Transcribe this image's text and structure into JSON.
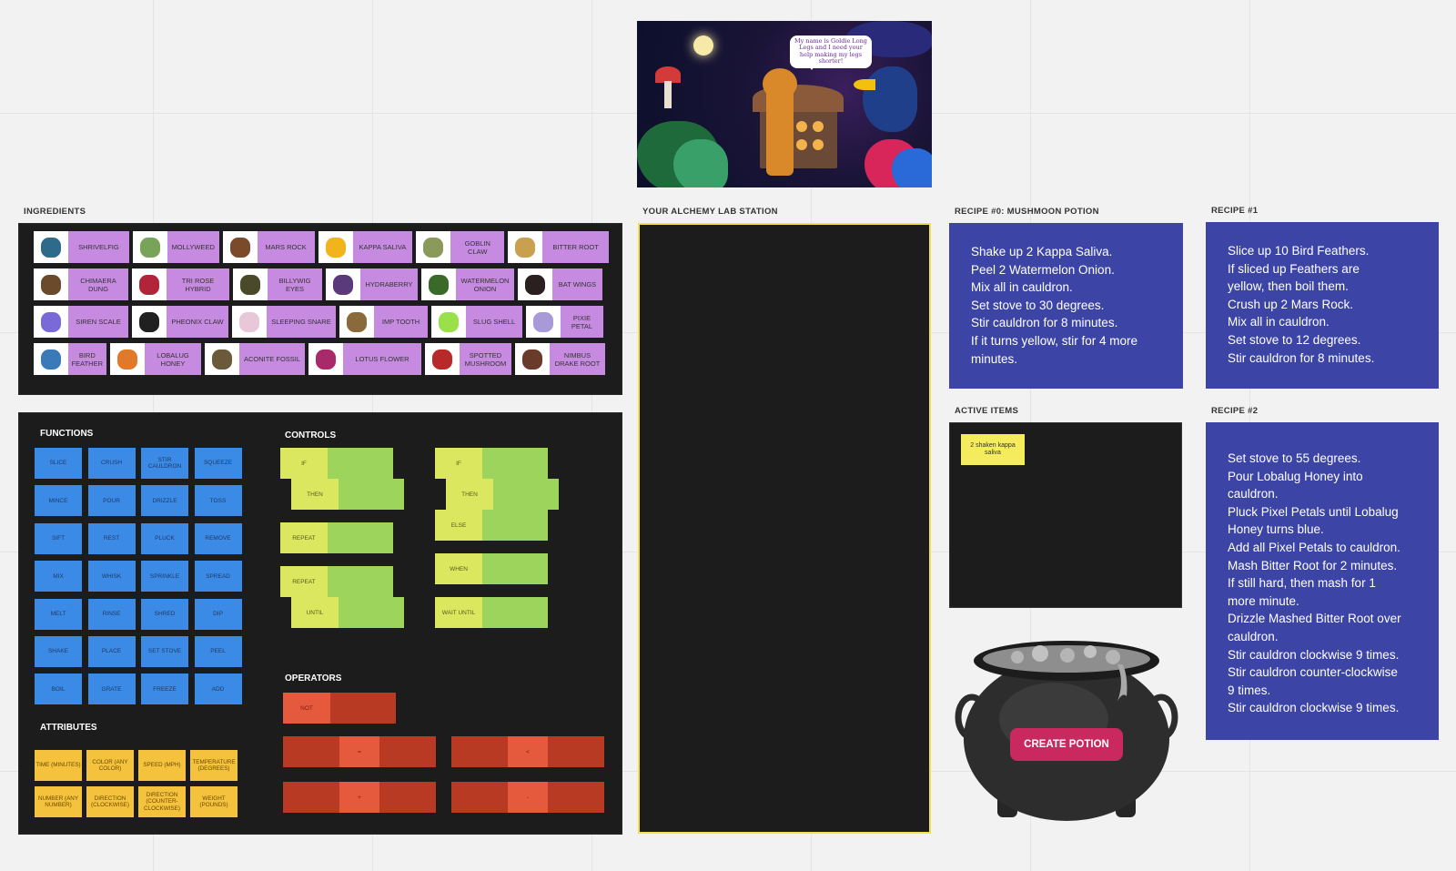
{
  "hero": {
    "speech": "My name is Goldie Long Legs and I need your help making my legs shorter!"
  },
  "sections": {
    "ingredients": "INGREDIENTS",
    "lab_station": "YOUR ALCHEMY LAB STATION",
    "recipe0": "RECIPE #0: MUSHMOON POTION",
    "recipe1": "RECIPE #1",
    "recipe2": "RECIPE #2",
    "active_items": "ACTIVE ITEMS"
  },
  "ingredients": [
    [
      {
        "label": "SHRIVELFIG",
        "color": "#2e6a8a"
      },
      {
        "label": "MOLLYWEED",
        "color": "#7aa35a"
      },
      {
        "label": "MARS ROCK",
        "color": "#7a4a2a"
      },
      {
        "label": "KAPPA SALIVA",
        "color": "#f2b41c"
      },
      {
        "label": "GOBLIN CLAW",
        "color": "#8a9a5a"
      },
      {
        "label": "BITTER ROOT",
        "color": "#c8a050"
      }
    ],
    [
      {
        "label": "CHIMAERA DUNG",
        "color": "#6a4a2a"
      },
      {
        "label": "TRI ROSE HYBRID",
        "color": "#b2243a"
      },
      {
        "label": "BILLYWIG EYES",
        "color": "#4a4a2a"
      },
      {
        "label": "HYDRABERRY",
        "color": "#5a3a7a"
      },
      {
        "label": "WATERMELON ONION",
        "color": "#3a6a2a"
      },
      {
        "label": "BAT WINGS",
        "color": "#2a2020"
      }
    ],
    [
      {
        "label": "SIREN SCALE",
        "color": "#7a6ad8"
      },
      {
        "label": "PHEONIX CLAW",
        "color": "#202020"
      },
      {
        "label": "SLEEPING SNARE",
        "color": "#e8c8d8"
      },
      {
        "label": "IMP TOOTH",
        "color": "#8a6a3a"
      },
      {
        "label": "SLUG SHELL",
        "color": "#9ae04a"
      },
      {
        "label": "PIXIE PETAL",
        "color": "#a89ad8"
      }
    ],
    [
      {
        "label": "BIRD FEATHER",
        "color": "#3a7ab8"
      },
      {
        "label": "LOBALUG HONEY",
        "color": "#e07a2a"
      },
      {
        "label": "ACONITE FOSSIL",
        "color": "#6a5a3a"
      },
      {
        "label": "LOTUS FLOWER",
        "color": "#a82a6a"
      },
      {
        "label": "SPOTTED MUSHROOM",
        "color": "#b82a2a"
      },
      {
        "label": "NIMBUS DRAKE ROOT",
        "color": "#6a3a2a"
      }
    ]
  ],
  "functions": {
    "title": "FUNCTIONS",
    "items": [
      "SLICE",
      "CRUSH",
      "STIR CAULDRON",
      "SQUEEZE",
      "MINCE",
      "POUR",
      "DRIZZLE",
      "TOSS",
      "SIFT",
      "REST",
      "PLUCK",
      "REMOVE",
      "MIX",
      "WHISK",
      "SPRINKLE",
      "SPREAD",
      "MELT",
      "RINSE",
      "SHRED",
      "DIP",
      "SHAKE",
      "PLACE",
      "SET STOVE",
      "PEEL",
      "BOIL",
      "GRATE",
      "FREEZE",
      "ADD"
    ]
  },
  "attributes": {
    "title": "ATTRIBUTES",
    "items": [
      "TIME (MINUTES)",
      "COLOR (ANY COLOR)",
      "SPEED (MPH)",
      "TEMPERATURE (DEGREES)",
      "NUMBER (ANY NUMBER)",
      "DIRECTION (CLOCKWISE)",
      "DIRECTION (COUNTER-CLOCKWISE)",
      "WEIGHT (POUNDS)"
    ]
  },
  "controls": {
    "title": "CONTROLS",
    "if1": "IF",
    "then1": "THEN",
    "if2": "IF",
    "then2": "THEN",
    "else2": "ELSE",
    "repeat1": "REPEAT",
    "repeat2": "REPEAT",
    "until": "UNTIL",
    "when": "WHEN",
    "wait_until": "WAIT UNTIL"
  },
  "operators": {
    "title": "OPERATORS",
    "not": "NOT",
    "op1": "=",
    "op2": "<",
    "op3": "+",
    "op4": "-"
  },
  "recipes": {
    "r0": [
      "Shake up 2 Kappa Saliva.",
      "Peel 2 Watermelon Onion.",
      "Mix all in cauldron.",
      "Set stove to 30 degrees.",
      "Stir cauldron for 8 minutes.",
      "If it turns yellow, stir for 4 more",
      "minutes."
    ],
    "r1": [
      "Slice up 10 Bird Feathers.",
      "If sliced up Feathers are",
      "yellow, then boil them.",
      "Crush up 2 Mars Rock.",
      "Mix all in cauldron.",
      "Set stove to 12 degrees.",
      "Stir cauldron for 8 minutes."
    ],
    "r2": [
      "Set stove to 55 degrees.",
      "Pour Lobalug Honey into",
      "cauldron.",
      "Pluck Pixel Petals until Lobalug",
      "Honey turns blue.",
      "Add all Pixel Petals to cauldron.",
      "Mash Bitter Root for 2 minutes.",
      "If still hard, then mash for 1",
      "more minute.",
      "Drizzle Mashed Bitter Root over",
      "cauldron.",
      "Stir cauldron clockwise 9 times.",
      "Stir cauldron counter-clockwise",
      "9 times.",
      "Stir cauldron clockwise 9 times."
    ]
  },
  "active_items": {
    "sticky": "2 shaken kappa saliva"
  },
  "create_button": "CREATE POTION"
}
